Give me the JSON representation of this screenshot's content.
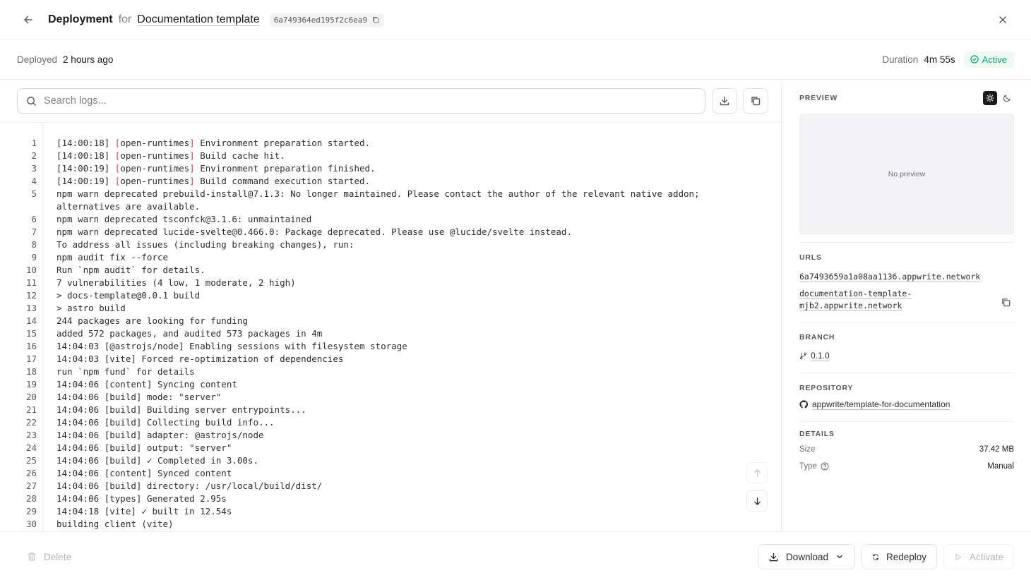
{
  "header": {
    "title": "Deployment",
    "for_label": "for",
    "project": "Documentation template",
    "deployment_id": "6a749364ed195f2c6ea9"
  },
  "info": {
    "deployed_label": "Deployed",
    "deployed_value": "2 hours ago",
    "duration_label": "Duration",
    "duration_value": "4m 55s",
    "status": "Active"
  },
  "search": {
    "placeholder": "Search logs..."
  },
  "logs": [
    {
      "n": "1",
      "ts": "[14:00:18] ",
      "src": "open-runtimes",
      "msg": " Environment preparation started."
    },
    {
      "n": "2",
      "ts": "[14:00:18] ",
      "src": "open-runtimes",
      "msg": " Build cache hit."
    },
    {
      "n": "3",
      "ts": "[14:00:19] ",
      "src": "open-runtimes",
      "msg": " Environment preparation finished."
    },
    {
      "n": "4",
      "ts": "[14:00:19] ",
      "src": "open-runtimes",
      "msg": " Build command execution started."
    },
    {
      "n": "5",
      "text": "npm warn deprecated prebuild-install@7.1.3: No longer maintained. Please contact the author of the relevant native addon; alternatives are available."
    },
    {
      "n": "6",
      "text": "npm warn deprecated tsconfck@3.1.6: unmaintained"
    },
    {
      "n": "7",
      "text": "npm warn deprecated lucide-svelte@0.466.0: Package deprecated. Please use @lucide/svelte instead."
    },
    {
      "n": "8",
      "text": "To address all issues (including breaking changes), run:"
    },
    {
      "n": "9",
      "text": "npm audit fix --force"
    },
    {
      "n": "10",
      "text": "Run `npm audit` for details."
    },
    {
      "n": "11",
      "text": "7 vulnerabilities (4 low, 1 moderate, 2 high)"
    },
    {
      "n": "12",
      "text": "> docs-template@0.0.1 build"
    },
    {
      "n": "13",
      "text": "> astro build"
    },
    {
      "n": "14",
      "text": "244 packages are looking for funding"
    },
    {
      "n": "15",
      "text": "added 572 packages, and audited 573 packages in 4m"
    },
    {
      "n": "16",
      "text": "14:04:03 [@astrojs/node] Enabling sessions with filesystem storage"
    },
    {
      "n": "17",
      "text": "14:04:03 [vite] Forced re-optimization of dependencies"
    },
    {
      "n": "18",
      "text": "run `npm fund` for details"
    },
    {
      "n": "19",
      "text": "14:04:06 [content] Syncing content"
    },
    {
      "n": "20",
      "text": "14:04:06 [build] mode: \"server\""
    },
    {
      "n": "21",
      "text": "14:04:06 [build] Building server entrypoints..."
    },
    {
      "n": "22",
      "text": "14:04:06 [build] Collecting build info..."
    },
    {
      "n": "23",
      "text": "14:04:06 [build] adapter: @astrojs/node"
    },
    {
      "n": "24",
      "text": "14:04:06 [build] output: \"server\""
    },
    {
      "n": "25",
      "text": "14:04:06 [build] ✓ Completed in 3.00s."
    },
    {
      "n": "26",
      "text": "14:04:06 [content] Synced content"
    },
    {
      "n": "27",
      "text": "14:04:06 [build] directory: /usr/local/build/dist/"
    },
    {
      "n": "28",
      "text": "14:04:06 [types] Generated 2.95s"
    },
    {
      "n": "29",
      "text": "14:04:18 [vite] ✓ built in 12.54s"
    },
    {
      "n": "30",
      "text": "building client (vite)"
    }
  ],
  "side": {
    "preview_label": "PREVIEW",
    "no_preview": "No preview",
    "urls_label": "URLS",
    "url_1": "6a7493659a1a08aa1136.appwrite.network",
    "url_2a": "documentation-template-",
    "url_2b": "mjb2.appwrite.network",
    "branch_label": "BRANCH",
    "branch": "0.1.0",
    "repository_label": "REPOSITORY",
    "repository": "appwrite/template-for-documentation",
    "details_label": "DETAILS",
    "size_label": "Size",
    "size_value": "37.42 MB",
    "type_label": "Type",
    "type_value": "Manual"
  },
  "footer": {
    "delete": "Delete",
    "download": "Download",
    "redeploy": "Redeploy",
    "activate": "Activate"
  },
  "colors": {
    "accent_active": "#0a9f6e",
    "bracket_red": "#d14a4a"
  }
}
